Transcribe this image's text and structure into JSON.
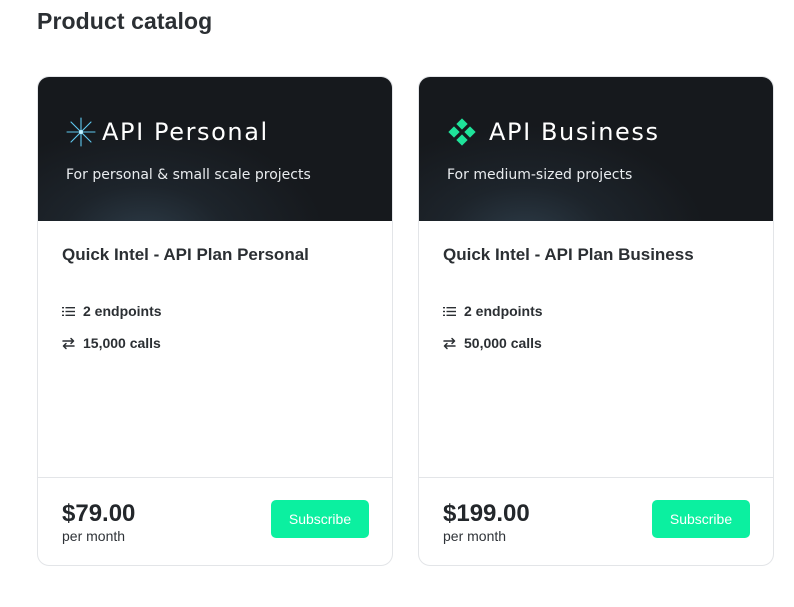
{
  "page": {
    "title": "Product catalog"
  },
  "colors": {
    "accent": "#0bf0a0",
    "hero_bg": "#16191d",
    "text": "#2b2f33"
  },
  "plans": [
    {
      "hero_name": "API Personal",
      "hero_subtitle": "For personal & small scale projects",
      "logo_icon": "sparkle-star-icon",
      "title": "Quick Intel - API Plan Personal",
      "features": [
        {
          "icon": "list-icon",
          "text": "2 endpoints"
        },
        {
          "icon": "arrows-exchange-icon",
          "text": "15,000 calls"
        }
      ],
      "price": "$79.00",
      "period": "per month",
      "cta": "Subscribe"
    },
    {
      "hero_name": "API Business",
      "hero_subtitle": "For medium-sized projects",
      "logo_icon": "diamond-cluster-icon",
      "title": "Quick Intel - API Plan Business",
      "features": [
        {
          "icon": "list-icon",
          "text": "2 endpoints"
        },
        {
          "icon": "arrows-exchange-icon",
          "text": "50,000 calls"
        }
      ],
      "price": "$199.00",
      "period": "per month",
      "cta": "Subscribe"
    }
  ]
}
